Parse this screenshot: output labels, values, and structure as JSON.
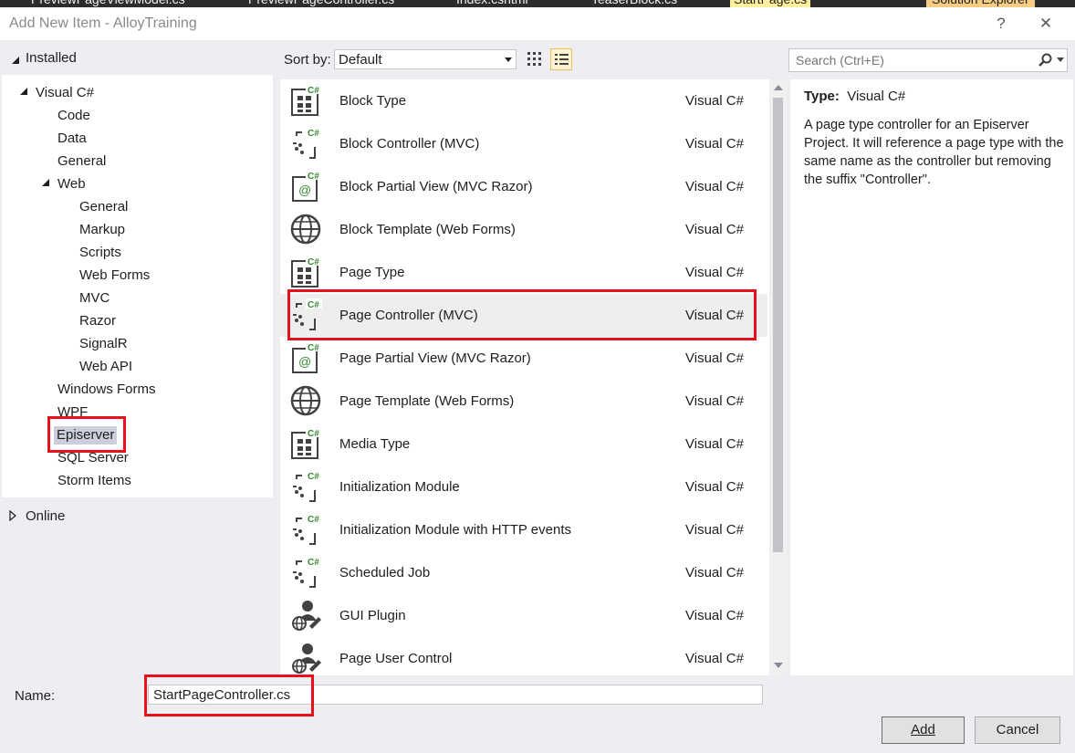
{
  "background_tabs": [
    "PreviewPageViewModel.cs",
    "PreviewPageController.cs",
    "Index.cshtml",
    "TeaserBlock.cs",
    "StartPage.cs",
    "Solution Explorer"
  ],
  "title": "Add New Item - AlloyTraining",
  "title_buttons": {
    "help": "?",
    "close": "✕"
  },
  "left": {
    "installed": "Installed",
    "tree": [
      "Visual C#",
      "Code",
      "Data",
      "General",
      "Web",
      "General",
      "Markup",
      "Scripts",
      "Web Forms",
      "MVC",
      "Razor",
      "SignalR",
      "Web API",
      "Windows Forms",
      "WPF",
      "Episerver",
      "SQL Server",
      "Storm Items"
    ],
    "online": "Online"
  },
  "toolbar": {
    "sort_label": "Sort by:",
    "sort_value": "Default",
    "search_placeholder": "Search (Ctrl+E)"
  },
  "items": [
    {
      "name": "Block Type",
      "lang": "Visual C#",
      "icon": "cs-grid-icon"
    },
    {
      "name": "Block Controller (MVC)",
      "lang": "Visual C#",
      "icon": "cs-controller-icon"
    },
    {
      "name": "Block Partial View (MVC Razor)",
      "lang": "Visual C#",
      "icon": "cs-razor-icon"
    },
    {
      "name": "Block Template (Web Forms)",
      "lang": "Visual C#",
      "icon": "globe-icon"
    },
    {
      "name": "Page Type",
      "lang": "Visual C#",
      "icon": "cs-grid-icon"
    },
    {
      "name": "Page Controller (MVC)",
      "lang": "Visual C#",
      "icon": "cs-controller-icon"
    },
    {
      "name": "Page Partial View (MVC Razor)",
      "lang": "Visual C#",
      "icon": "cs-razor-icon"
    },
    {
      "name": "Page Template (Web Forms)",
      "lang": "Visual C#",
      "icon": "globe-icon"
    },
    {
      "name": "Media Type",
      "lang": "Visual C#",
      "icon": "cs-grid-icon"
    },
    {
      "name": "Initialization Module",
      "lang": "Visual C#",
      "icon": "cs-controller-icon"
    },
    {
      "name": "Initialization Module with HTTP events",
      "lang": "Visual C#",
      "icon": "cs-controller-icon"
    },
    {
      "name": "Scheduled Job",
      "lang": "Visual C#",
      "icon": "cs-controller-icon"
    },
    {
      "name": "GUI Plugin",
      "lang": "Visual C#",
      "icon": "user-plugin-icon"
    },
    {
      "name": "Page User Control",
      "lang": "Visual C#",
      "icon": "user-plugin-icon"
    }
  ],
  "details": {
    "type_label": "Type:",
    "type_value": "Visual C#",
    "description": "A page type controller for an Episerver Project. It will reference a page type with the same name as the controller but removing the suffix \"Controller\"."
  },
  "bottom": {
    "name_label": "Name:",
    "name_value": "StartPageController.cs",
    "add_label": "Add",
    "cancel_label": "Cancel"
  },
  "colors": {
    "highlight_red": "#e8111b",
    "selection": "#eeeeee",
    "tree_selection": "#cccedb"
  }
}
